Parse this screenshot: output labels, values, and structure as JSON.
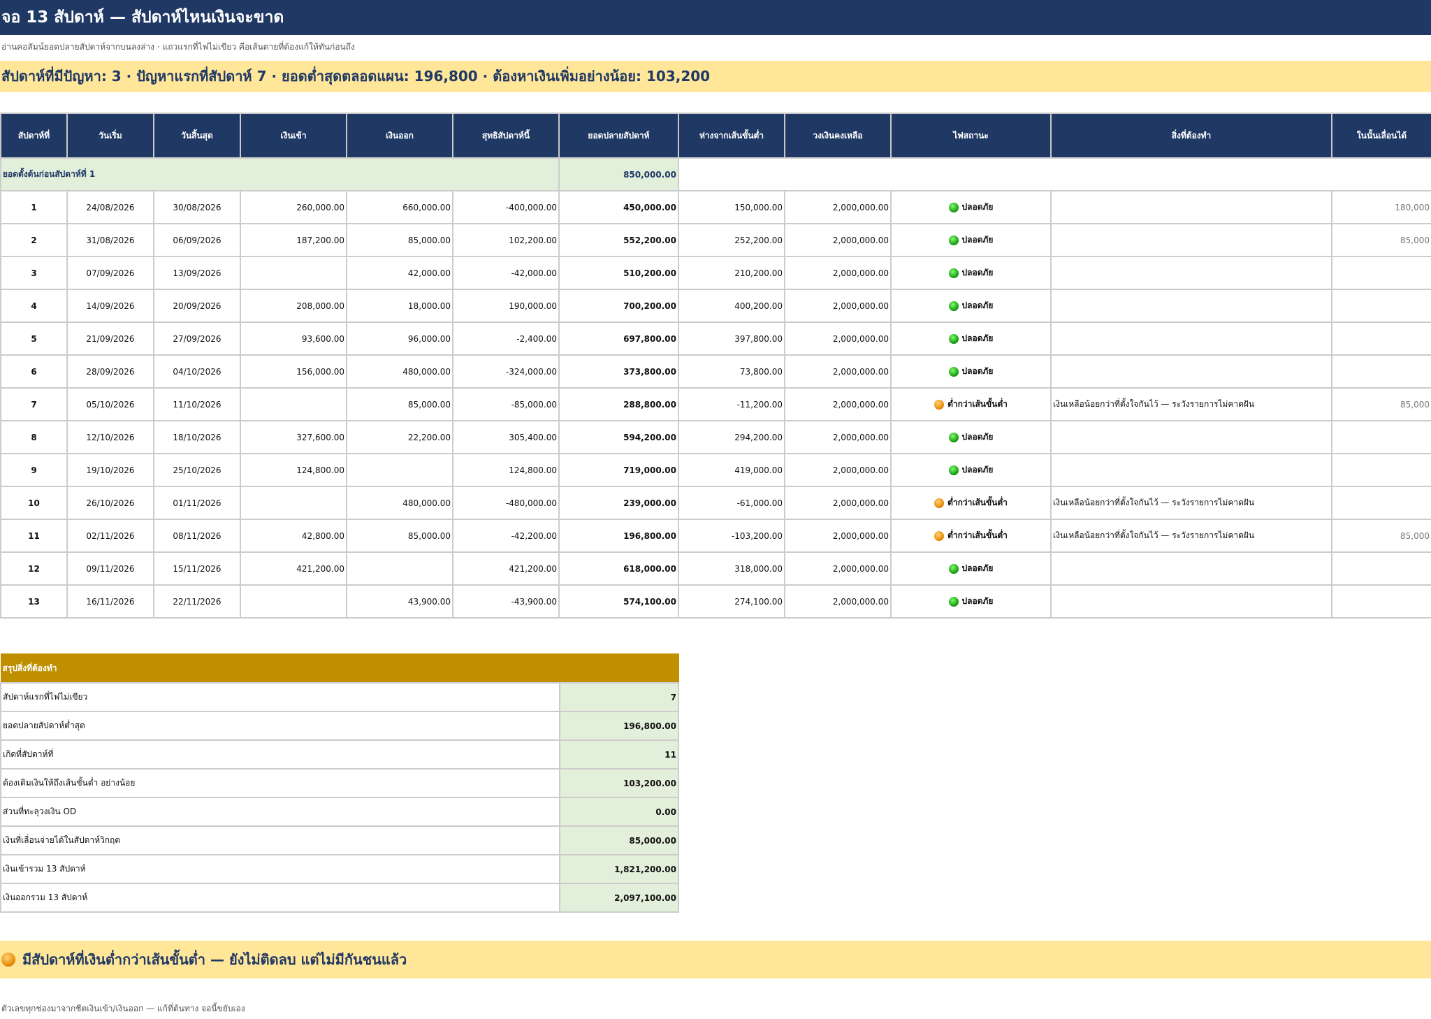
{
  "title": "จอ 13 สัปดาห์ — สัปดาห์ไหนเงินจะขาด",
  "subtitle": "อ่านคอลัมน์ยอดปลายสัปดาห์จากบนลงล่าง · แถวแรกที่ไฟไม่เขียว คือเส้นตายที่ต้องแก้ให้ทันก่อนถึง",
  "problem_summary": "สัปดาห์ที่มีปัญหา: 3 · ปัญหาแรกที่สัปดาห์ 7 · ยอดต่ำสุดตลอดแผน: 196,800 · ต้องหาเงินเพิ่มอย่างน้อย: 103,200",
  "colors": {
    "header": "#1f3864",
    "highlight": "#ffe699",
    "summary_header": "#bf8f00",
    "cell_green": "#e2efda"
  },
  "headers": [
    "สัปดาห์ที่",
    "วันเริ่ม",
    "วันสิ้นสุด",
    "เงินเข้า",
    "เงินออก",
    "สุทธิสัปดาห์นี้",
    "ยอดปลายสัปดาห์",
    "ห่างจากเส้นขั้นต่ำ",
    "วงเงินคงเหลือ",
    "ไฟสถานะ",
    "สิ่งที่ต้องทำ",
    "ในนั้นเลื่อนได้"
  ],
  "opening": {
    "label": "ยอดตั้งต้นก่อนสัปดาห์ที่ 1",
    "value": "850,000.00"
  },
  "rows": [
    {
      "week": "1",
      "start": "24/08/2026",
      "end": "30/08/2026",
      "in": "260,000.00",
      "out": "660,000.00",
      "net": "-400,000.00",
      "closing": "450,000.00",
      "gap": "150,000.00",
      "credit": "2,000,000.00",
      "status": "ปลอดภัย",
      "status_icon": "green",
      "action": "",
      "deferrable": "180,000"
    },
    {
      "week": "2",
      "start": "31/08/2026",
      "end": "06/09/2026",
      "in": "187,200.00",
      "out": "85,000.00",
      "net": "102,200.00",
      "closing": "552,200.00",
      "gap": "252,200.00",
      "credit": "2,000,000.00",
      "status": "ปลอดภัย",
      "status_icon": "green",
      "action": "",
      "deferrable": "85,000"
    },
    {
      "week": "3",
      "start": "07/09/2026",
      "end": "13/09/2026",
      "in": "",
      "out": "42,000.00",
      "net": "-42,000.00",
      "closing": "510,200.00",
      "gap": "210,200.00",
      "credit": "2,000,000.00",
      "status": "ปลอดภัย",
      "status_icon": "green",
      "action": "",
      "deferrable": ""
    },
    {
      "week": "4",
      "start": "14/09/2026",
      "end": "20/09/2026",
      "in": "208,000.00",
      "out": "18,000.00",
      "net": "190,000.00",
      "closing": "700,200.00",
      "gap": "400,200.00",
      "credit": "2,000,000.00",
      "status": "ปลอดภัย",
      "status_icon": "green",
      "action": "",
      "deferrable": ""
    },
    {
      "week": "5",
      "start": "21/09/2026",
      "end": "27/09/2026",
      "in": "93,600.00",
      "out": "96,000.00",
      "net": "-2,400.00",
      "closing": "697,800.00",
      "gap": "397,800.00",
      "credit": "2,000,000.00",
      "status": "ปลอดภัย",
      "status_icon": "green",
      "action": "",
      "deferrable": ""
    },
    {
      "week": "6",
      "start": "28/09/2026",
      "end": "04/10/2026",
      "in": "156,000.00",
      "out": "480,000.00",
      "net": "-324,000.00",
      "closing": "373,800.00",
      "gap": "73,800.00",
      "credit": "2,000,000.00",
      "status": "ปลอดภัย",
      "status_icon": "green",
      "action": "",
      "deferrable": ""
    },
    {
      "week": "7",
      "start": "05/10/2026",
      "end": "11/10/2026",
      "in": "",
      "out": "85,000.00",
      "net": "-85,000.00",
      "closing": "288,800.00",
      "gap": "-11,200.00",
      "credit": "2,000,000.00",
      "status": "ต่ำกว่าเส้นขั้นต่ำ",
      "status_icon": "orange",
      "action": "เงินเหลือน้อยกว่าที่ตั้งใจกันไว้ — ระวังรายการไม่คาดฝัน",
      "deferrable": "85,000"
    },
    {
      "week": "8",
      "start": "12/10/2026",
      "end": "18/10/2026",
      "in": "327,600.00",
      "out": "22,200.00",
      "net": "305,400.00",
      "closing": "594,200.00",
      "gap": "294,200.00",
      "credit": "2,000,000.00",
      "status": "ปลอดภัย",
      "status_icon": "green",
      "action": "",
      "deferrable": ""
    },
    {
      "week": "9",
      "start": "19/10/2026",
      "end": "25/10/2026",
      "in": "124,800.00",
      "out": "",
      "net": "124,800.00",
      "closing": "719,000.00",
      "gap": "419,000.00",
      "credit": "2,000,000.00",
      "status": "ปลอดภัย",
      "status_icon": "green",
      "action": "",
      "deferrable": ""
    },
    {
      "week": "10",
      "start": "26/10/2026",
      "end": "01/11/2026",
      "in": "",
      "out": "480,000.00",
      "net": "-480,000.00",
      "closing": "239,000.00",
      "gap": "-61,000.00",
      "credit": "2,000,000.00",
      "status": "ต่ำกว่าเส้นขั้นต่ำ",
      "status_icon": "orange",
      "action": "เงินเหลือน้อยกว่าที่ตั้งใจกันไว้ — ระวังรายการไม่คาดฝัน",
      "deferrable": ""
    },
    {
      "week": "11",
      "start": "02/11/2026",
      "end": "08/11/2026",
      "in": "42,800.00",
      "out": "85,000.00",
      "net": "-42,200.00",
      "closing": "196,800.00",
      "gap": "-103,200.00",
      "credit": "2,000,000.00",
      "status": "ต่ำกว่าเส้นขั้นต่ำ",
      "status_icon": "orange",
      "action": "เงินเหลือน้อยกว่าที่ตั้งใจกันไว้ — ระวังรายการไม่คาดฝัน",
      "deferrable": "85,000"
    },
    {
      "week": "12",
      "start": "09/11/2026",
      "end": "15/11/2026",
      "in": "421,200.00",
      "out": "",
      "net": "421,200.00",
      "closing": "618,000.00",
      "gap": "318,000.00",
      "credit": "2,000,000.00",
      "status": "ปลอดภัย",
      "status_icon": "green",
      "action": "",
      "deferrable": ""
    },
    {
      "week": "13",
      "start": "16/11/2026",
      "end": "22/11/2026",
      "in": "",
      "out": "43,900.00",
      "net": "-43,900.00",
      "closing": "574,100.00",
      "gap": "274,100.00",
      "credit": "2,000,000.00",
      "status": "ปลอดภัย",
      "status_icon": "green",
      "action": "",
      "deferrable": ""
    }
  ],
  "summary": {
    "title": "สรุปสิ่งที่ต้องทำ",
    "items": [
      {
        "label": "สัปดาห์แรกที่ไฟไม่เขียว",
        "value": "7"
      },
      {
        "label": "ยอดปลายสัปดาห์ต่ำสุด",
        "value": "196,800.00"
      },
      {
        "label": "เกิดที่สัปดาห์ที่",
        "value": "11"
      },
      {
        "label": "ต้องเติมเงินให้ถึงเส้นขั้นต่ำ อย่างน้อย",
        "value": "103,200.00"
      },
      {
        "label": "ส่วนที่ทะลุวงเงิน OD",
        "value": "0.00"
      },
      {
        "label": "เงินที่เลื่อนจ่ายได้ในสัปดาห์วิกฤต",
        "value": "85,000.00"
      },
      {
        "label": "เงินเข้ารวม 13 สัปดาห์",
        "value": "1,821,200.00"
      },
      {
        "label": "เงินออกรวม 13 สัปดาห์",
        "value": "2,097,100.00"
      }
    ]
  },
  "verdict": {
    "icon": "orange",
    "text": "มีสัปดาห์ที่เงินต่ำกว่าเส้นขั้นต่ำ — ยังไม่ติดลบ แต่ไม่มีกันชนแล้ว"
  },
  "footnote": "ตัวเลขทุกช่องมาจากชีตเงินเข้า/เงินออก — แก้ที่ต้นทาง จอนี้ขยับเอง"
}
